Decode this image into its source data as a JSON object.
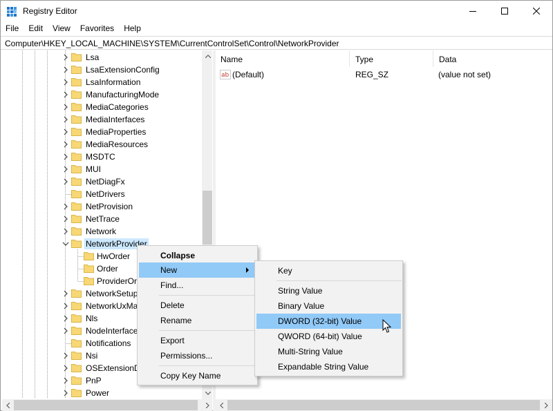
{
  "window": {
    "title": "Registry Editor",
    "icon": "registry-editor-icon",
    "controls": [
      "minimize-icon",
      "maximize-icon",
      "close-icon"
    ]
  },
  "menu": {
    "items": [
      "File",
      "Edit",
      "View",
      "Favorites",
      "Help"
    ]
  },
  "address": {
    "path": "Computer\\HKEY_LOCAL_MACHINE\\SYSTEM\\CurrentControlSet\\Control\\NetworkProvider"
  },
  "tree": {
    "items": [
      {
        "label": "Lsa",
        "chevron": "right"
      },
      {
        "label": "LsaExtensionConfig",
        "chevron": "right"
      },
      {
        "label": "LsaInformation",
        "chevron": "right"
      },
      {
        "label": "ManufacturingMode",
        "chevron": "right"
      },
      {
        "label": "MediaCategories",
        "chevron": "right"
      },
      {
        "label": "MediaInterfaces",
        "chevron": "right"
      },
      {
        "label": "MediaProperties",
        "chevron": "right"
      },
      {
        "label": "MediaResources",
        "chevron": "right"
      },
      {
        "label": "MSDTC",
        "chevron": "right"
      },
      {
        "label": "MUI",
        "chevron": "right"
      },
      {
        "label": "NetDiagFx",
        "chevron": "right"
      },
      {
        "label": "NetDrivers",
        "chevron": "none"
      },
      {
        "label": "NetProvision",
        "chevron": "right"
      },
      {
        "label": "NetTrace",
        "chevron": "right"
      },
      {
        "label": "Network",
        "chevron": "right"
      },
      {
        "label": "NetworkProvider",
        "chevron": "down",
        "selected": true
      },
      {
        "label": "HwOrder",
        "chevron": "none",
        "child": true
      },
      {
        "label": "Order",
        "chevron": "none",
        "child": true
      },
      {
        "label": "ProviderOrder",
        "chevron": "none",
        "child": true
      },
      {
        "label": "NetworkSetup2",
        "chevron": "right"
      },
      {
        "label": "NetworkUxManager",
        "chevron": "right"
      },
      {
        "label": "Nls",
        "chevron": "right"
      },
      {
        "label": "NodeInterfaces",
        "chevron": "right"
      },
      {
        "label": "Notifications",
        "chevron": "none"
      },
      {
        "label": "Nsi",
        "chevron": "right"
      },
      {
        "label": "OSExtensionDatabase",
        "chevron": "right"
      },
      {
        "label": "PnP",
        "chevron": "right"
      },
      {
        "label": "Power",
        "chevron": "right"
      }
    ]
  },
  "values": {
    "columns": [
      "Name",
      "Type",
      "Data"
    ],
    "rows": [
      {
        "icon": "string-value-icon",
        "name": "(Default)",
        "type": "REG_SZ",
        "data": "(value not set)"
      }
    ]
  },
  "context_menu": {
    "items": [
      {
        "label": "Collapse",
        "bold": true
      },
      {
        "label": "New",
        "submenu": true,
        "highlighted": true
      },
      {
        "label": "Find..."
      },
      {
        "label": "Delete"
      },
      {
        "label": "Rename"
      },
      {
        "label": "Export"
      },
      {
        "label": "Permissions..."
      },
      {
        "label": "Copy Key Name"
      }
    ]
  },
  "new_submenu": {
    "items": [
      {
        "label": "Key"
      },
      {
        "label": "String Value"
      },
      {
        "label": "Binary Value"
      },
      {
        "label": "DWORD (32-bit) Value",
        "highlighted": true
      },
      {
        "label": "QWORD (64-bit) Value"
      },
      {
        "label": "Multi-String Value"
      },
      {
        "label": "Expandable String Value"
      }
    ]
  },
  "colors": {
    "selection": "#cce8ff",
    "menu_highlight": "#91c9f7",
    "menu_bg": "#f2f2f2",
    "folder": "#f8d775"
  }
}
